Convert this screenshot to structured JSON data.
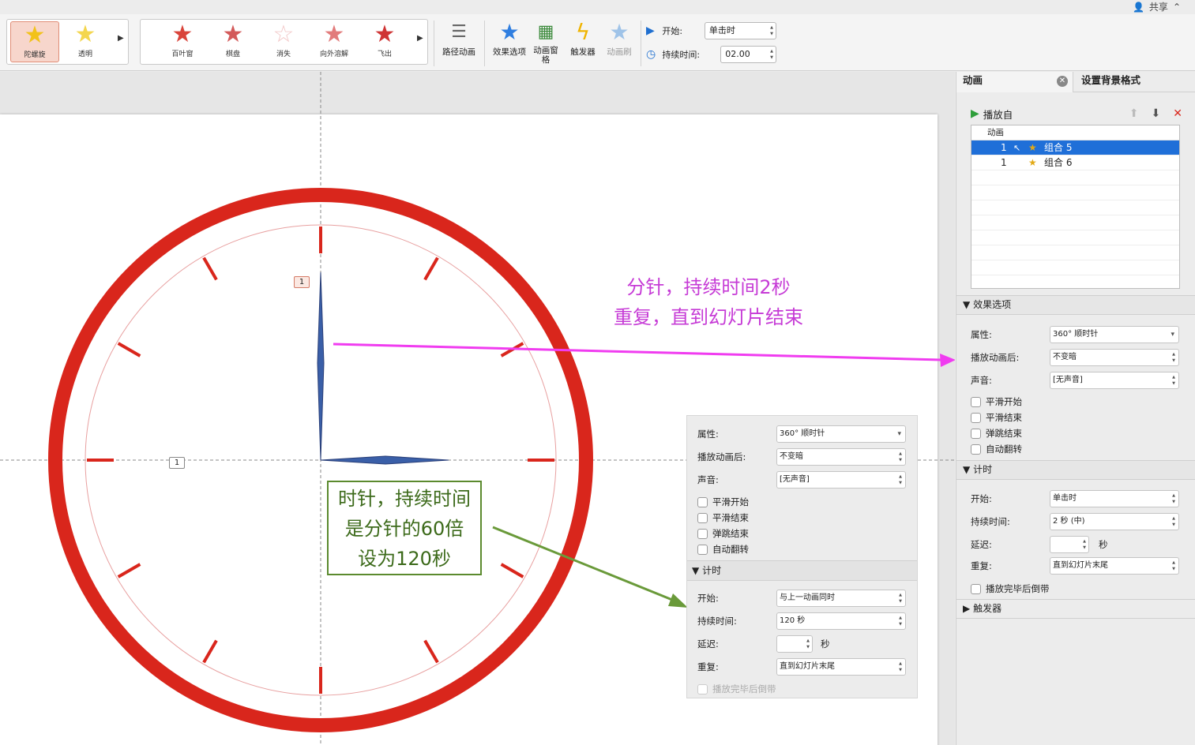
{
  "share_label": "共享",
  "ribbon": {
    "gallery_effects": [
      {
        "label": "陀螺旋",
        "icon": "spin-star-icon",
        "selected": true
      },
      {
        "label": "透明",
        "icon": "transparent-star-icon",
        "selected": false
      }
    ],
    "gallery_exit": [
      {
        "label": "百叶窗",
        "icon": "blinds-star-icon"
      },
      {
        "label": "棋盘",
        "icon": "checkerboard-star-icon"
      },
      {
        "label": "消失",
        "icon": "disappear-star-icon"
      },
      {
        "label": "向外溶解",
        "icon": "dissolve-out-star-icon"
      },
      {
        "label": "飞出",
        "icon": "fly-out-star-icon"
      }
    ],
    "path_animation": "路径动画",
    "effect_options": "效果选项",
    "animation_pane": "动画窗格",
    "trigger": "触发器",
    "animation_painter": "动画刷",
    "start_label": "开始:",
    "start_value": "单击时",
    "duration_label": "持续时间:",
    "duration_value": "02.00"
  },
  "slide": {
    "annotation_minute": [
      "分针，持续时间2秒",
      "重复，直到幻灯片结束"
    ],
    "annotation_hour": [
      "时针，持续时间",
      "是分针的60倍",
      "设为120秒"
    ],
    "tag_minute": "1",
    "tag_hour": "1"
  },
  "float_panel": {
    "property_label": "属性:",
    "property_value": "360° 顺时针",
    "after_label": "播放动画后:",
    "after_value": "不变暗",
    "sound_label": "声音:",
    "sound_value": "[无声音]",
    "checks": [
      "平滑开始",
      "平滑结束",
      "弹跳结束",
      "自动翻转"
    ],
    "timing_section": "计时",
    "start_label": "开始:",
    "start_value": "与上一动画同时",
    "duration_label": "持续时间:",
    "duration_value": "120 秒",
    "delay_label": "延迟:",
    "delay_unit": "秒",
    "repeat_label": "重复:",
    "repeat_value": "直到幻灯片末尾",
    "rewind_label": "播放完毕后倒带"
  },
  "pane": {
    "tab_animation": "动画",
    "tab_background": "设置背景格式",
    "play_from": "播放自",
    "list_header": "动画",
    "items": [
      {
        "num": "1",
        "name": "组合 5",
        "selected": true
      },
      {
        "num": "1",
        "name": "组合 6",
        "selected": false
      }
    ],
    "effect_section": "效果选项",
    "property_label": "属性:",
    "property_value": "360° 顺时针",
    "after_label": "播放动画后:",
    "after_value": "不变暗",
    "sound_label": "声音:",
    "sound_value": "[无声音]",
    "checks": [
      "平滑开始",
      "平滑结束",
      "弹跳结束",
      "自动翻转"
    ],
    "timing_section": "计时",
    "start_label": "开始:",
    "start_value": "单击时",
    "duration_label": "持续时间:",
    "duration_value": "2 秒 (中)",
    "delay_label": "延迟:",
    "delay_unit": "秒",
    "repeat_label": "重复:",
    "repeat_value": "直到幻灯片末尾",
    "rewind_label": "播放完毕后倒带",
    "trigger_section": "触发器"
  },
  "colors": {
    "clock_red": "#d9261c",
    "hand_blue": "#3a5fa8",
    "arrow_magenta": "#f03cf0",
    "arrow_green": "#6a9a3a",
    "selection_blue": "#1f6fd8"
  }
}
